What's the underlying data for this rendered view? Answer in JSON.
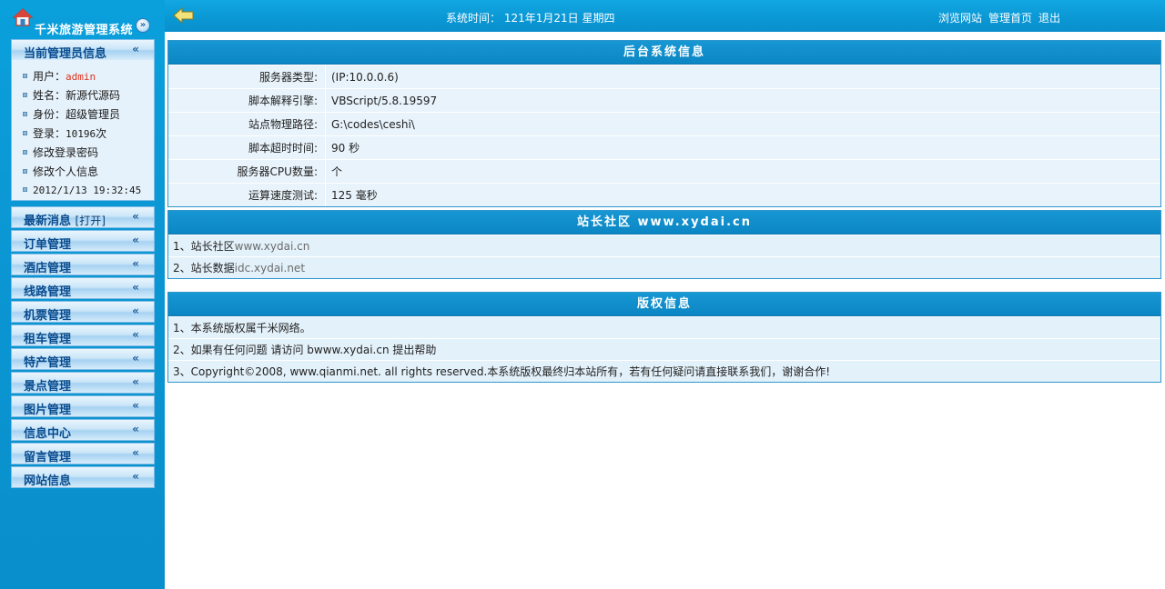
{
  "sidebar": {
    "system_title": "千米旅游管理系统",
    "admin_panel": {
      "title": "当前管理员信息",
      "user_label": "用户：",
      "user_value": "admin",
      "name_text": "姓名：新源代源码",
      "role_text": "身份：超级管理员",
      "login_label": "登录：",
      "login_value": "10196",
      "login_suffix": "次",
      "change_password": "修改登录密码",
      "edit_profile": "修改个人信息",
      "last_login": "2012/1/13 19:32:45"
    },
    "menus": [
      {
        "label": "最新消息",
        "extra": "[打开]"
      },
      {
        "label": "订单管理"
      },
      {
        "label": "酒店管理"
      },
      {
        "label": "线路管理"
      },
      {
        "label": "机票管理"
      },
      {
        "label": "租车管理"
      },
      {
        "label": "特产管理"
      },
      {
        "label": "景点管理"
      },
      {
        "label": "图片管理"
      },
      {
        "label": "信息中心"
      },
      {
        "label": "留言管理"
      },
      {
        "label": "网站信息"
      }
    ]
  },
  "topbar": {
    "system_time": "系统时间： 121年1月21日 星期四",
    "links": [
      "浏览网站",
      "管理首页",
      "退出"
    ]
  },
  "sysinfo": {
    "title": "后台系统信息",
    "rows": [
      {
        "label": "服务器类型:",
        "value": "(IP:10.0.0.6)"
      },
      {
        "label": "脚本解释引擎:",
        "value": "VBScript/5.8.19597"
      },
      {
        "label": "站点物理路径:",
        "value": "G:\\codes\\ceshi\\"
      },
      {
        "label": "脚本超时时间:",
        "value": "90 秒"
      },
      {
        "label": "服务器CPU数量:",
        "value": "个"
      },
      {
        "label": "运算速度测试:",
        "value": "125 毫秒"
      }
    ]
  },
  "community": {
    "title": "站长社区 www.xydai.cn",
    "rows": [
      {
        "prefix": "1、站长社区",
        "link": "www.xydai.cn"
      },
      {
        "prefix": "2、站长数据",
        "link": "idc.xydai.net"
      }
    ]
  },
  "copyright": {
    "title": "版权信息",
    "rows": [
      "1、本系统版权属千米网络。",
      "2、如果有任何问题 请访问 bwww.xydai.cn 提出帮助",
      "3、Copyright©2008, www.qianmi.net. all rights reserved.本系统版权最终归本站所有，若有任何疑问请直接联系我们，谢谢合作!"
    ]
  }
}
